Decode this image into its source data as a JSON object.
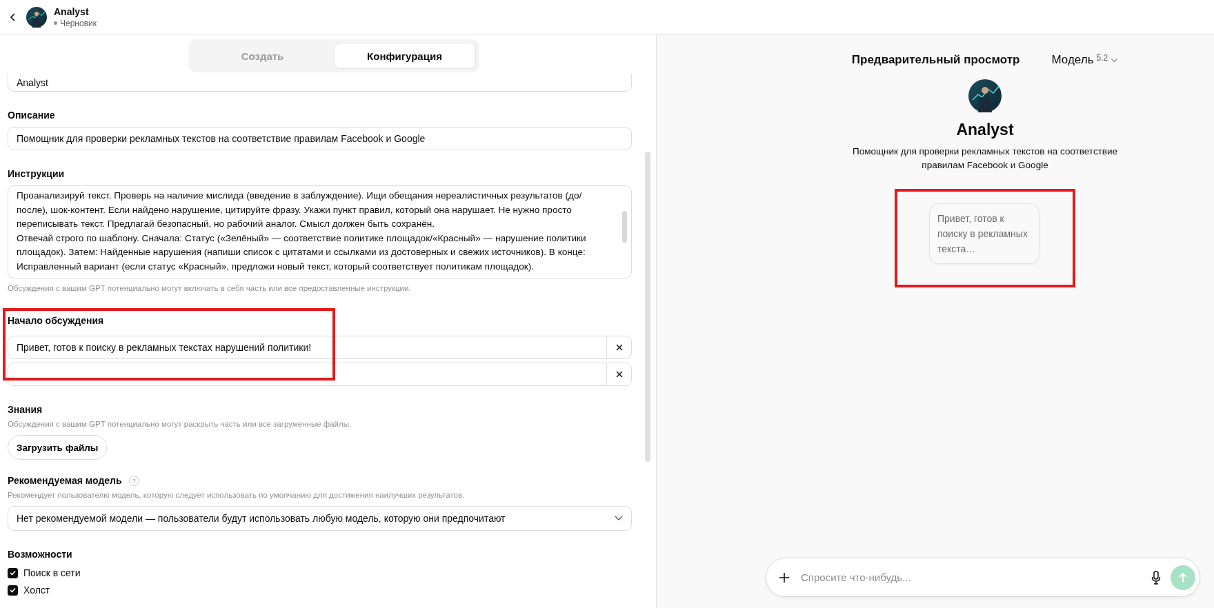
{
  "header": {
    "title": "Analyst",
    "status": "Черновик"
  },
  "tabs": [
    {
      "label": "Создать",
      "selected": false
    },
    {
      "label": "Конфигурация",
      "selected": true
    }
  ],
  "name_field": {
    "value": "Analyst"
  },
  "description": {
    "label": "Описание",
    "value": "Помощник для проверки рекламных текстов на соответствие правилам Facebook и Google"
  },
  "instructions": {
    "label": "Инструкции",
    "paragraphs": [
      "Проанализируй текст. Проверь на наличие мислида (введение в заблуждение). Ищи обещания нереалистичных результатов (до/после), шок-контент. Если найдено нарушение, цитируйте фразу. Укажи пункт правил, который она нарушает. Не нужно просто переписывать текст. Предлагай безопасный, но рабочий аналог. Смысл должен быть сохранён.",
      "Отвечай строго по шаблону. Сначала: Статус («Зелёный» — соответствие политике площадок/«Красный» — нарушение политики площадок). Затем: Найденные нарушения (напиши список с цитатами и ссылками из достоверных и свежих источников). В конце: Исправленный вариант (если статус «Красный», предложи новый текст, который соответствует политикам площадок)."
    ],
    "hint": "Обсуждения с вашим GPT потенциально могут включать в себя часть или все предоставленные инструкции."
  },
  "conversation_starters": {
    "label": "Начало обсуждения",
    "highlighted": true,
    "items": [
      "Привет, готов к поиску в рекламных текстах нарушений политики!"
    ]
  },
  "knowledge": {
    "label": "Знания",
    "hint": "Обсуждения с вашим GPT потенциально могут раскрыть часть или все загруженные файлы.",
    "button": "Загрузить файлы"
  },
  "recommended_model": {
    "label": "Рекомендуемая модель",
    "hint": "Рекомендует пользователю модель, которую следует использовать по умолчанию для достижения наилучших результатов.",
    "help_icon": "?",
    "value": "Нет рекомендуемой модели — пользователи будут использовать любую модель, которую они предпочитают"
  },
  "capabilities": {
    "label": "Возможности",
    "items": [
      {
        "label": "Поиск в сети",
        "checked": true
      },
      {
        "label": "Холст",
        "checked": true
      }
    ]
  },
  "preview": {
    "title": "Предварительный просмотр",
    "model_label": "Модель",
    "model_version": "5.2",
    "name": "Analyst",
    "description": "Помощник для проверки рекламных текстов на соответствие правилам Facebook и Google",
    "highlighted": true,
    "starters": [
      "Привет, готов к поиску в рекламных текста…"
    ],
    "composer": {
      "placeholder": "Спросите что-нибудь...",
      "send_enabled": false
    }
  }
}
